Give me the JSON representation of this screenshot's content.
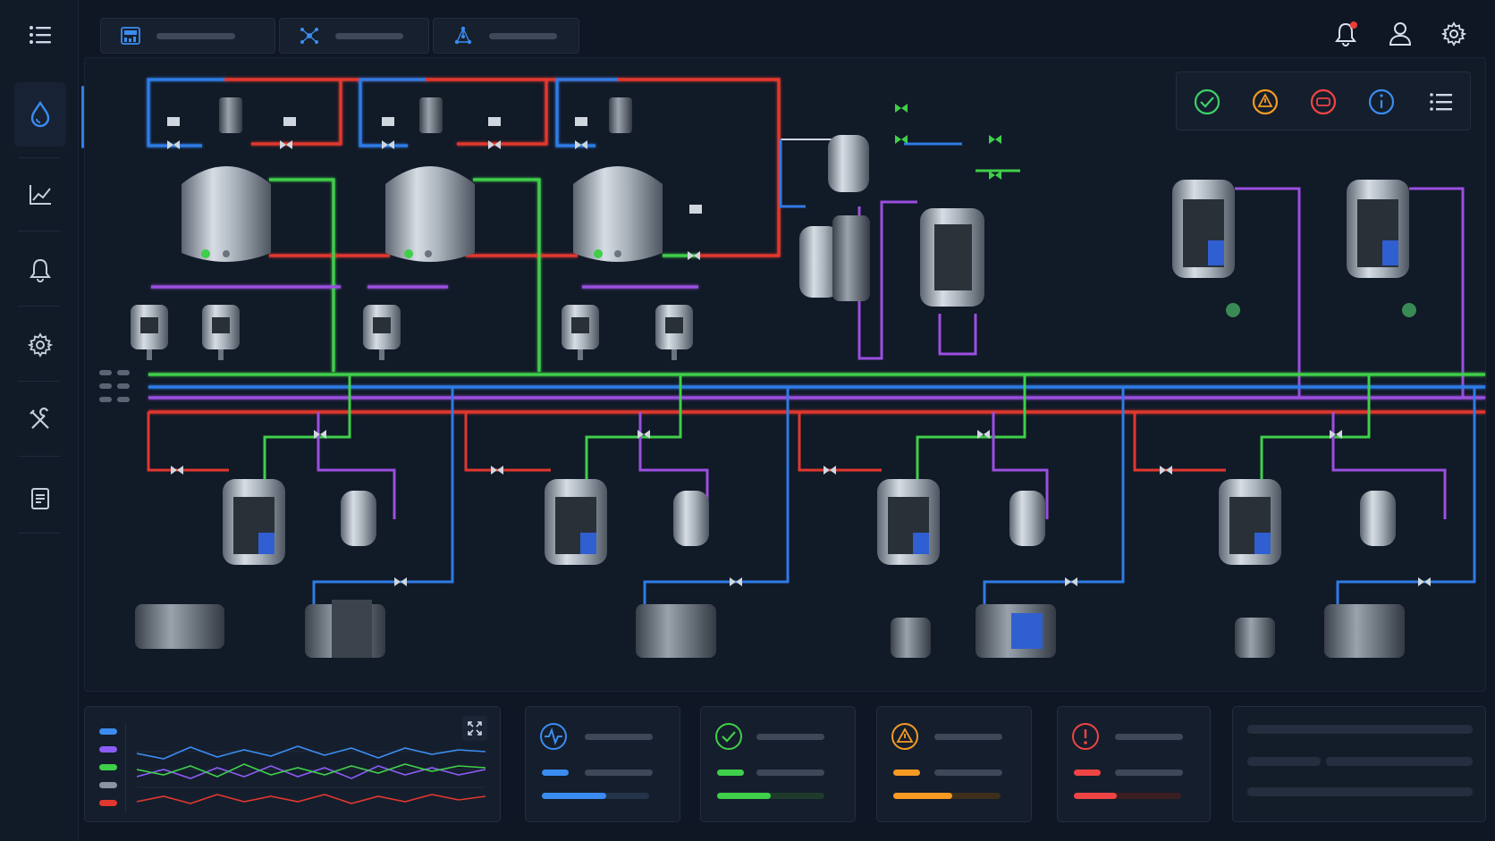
{
  "nav": {
    "menu_icon": "hamburger-menu-icon",
    "items": [
      {
        "name": "process",
        "icon": "droplet-icon",
        "active": true
      },
      {
        "name": "trends",
        "icon": "line-chart-icon",
        "active": false
      },
      {
        "name": "alarms",
        "icon": "bell-icon",
        "active": false
      },
      {
        "name": "settings",
        "icon": "gear-icon",
        "active": false
      },
      {
        "name": "maintenance",
        "icon": "tools-icon",
        "active": false
      },
      {
        "name": "reports",
        "icon": "document-icon",
        "active": false
      }
    ]
  },
  "tabs": [
    {
      "icon": "dashboard-icon"
    },
    {
      "icon": "network-icon"
    },
    {
      "icon": "topology-icon"
    }
  ],
  "header": {
    "notification_icon": "bell-icon",
    "user_icon": "user-icon",
    "settings_icon": "gear-icon"
  },
  "status_filters": [
    {
      "icon": "check-circle-icon",
      "color": "#3dd16a"
    },
    {
      "icon": "warning-triangle-icon",
      "color": "#f59a23"
    },
    {
      "icon": "error-icon",
      "color": "#ef4444"
    },
    {
      "icon": "info-icon",
      "color": "#3b8cf0"
    },
    {
      "icon": "list-icon",
      "color": "#cfd8e6"
    }
  ],
  "pipe_colors": {
    "hot": "#e2372f",
    "cold": "#2f7be6",
    "process": "#3fcf4a",
    "recirc": "#9b4fe0"
  },
  "trend_chart": {
    "expand_icon": "expand-icon",
    "legend_colors": [
      "#3b8cf0",
      "#8b5cf6",
      "#3fcf4a",
      "#8a94a3",
      "#e2372f"
    ]
  },
  "kpi_cards": [
    {
      "icon": "pulse-icon",
      "color": "#3b8cf0",
      "progress": 0.6
    },
    {
      "icon": "check-circle-icon",
      "color": "#3fcf4a",
      "progress": 0.5
    },
    {
      "icon": "warning-triangle-icon",
      "color": "#f59a23",
      "progress": 0.55
    },
    {
      "icon": "alert-circle-icon",
      "color": "#ef4444",
      "progress": 0.4
    }
  ]
}
